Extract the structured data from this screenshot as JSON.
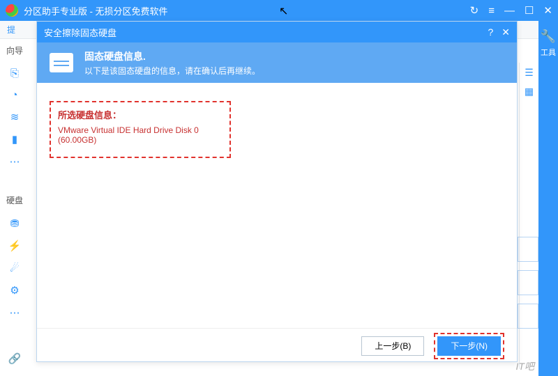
{
  "title_bar": {
    "title": "分区助手专业版 - 无损分区免费软件"
  },
  "search_strip": {
    "hint": "提"
  },
  "sidebar": {
    "section1_label": "向导",
    "section2_label": "硬盘"
  },
  "right_edge": {
    "tools_label": "工具"
  },
  "right_quick": {
    "grid_label": "☰",
    "list_label": "▦"
  },
  "dialog": {
    "title": "安全擦除固态硬盘",
    "banner": {
      "heading": "固态硬盘信息.",
      "subtitle": "以下是该固态硬盘的信息，请在确认后再继续。"
    },
    "info": {
      "header": "所选硬盘信息：",
      "line": "VMware Virtual IDE Hard Drive Disk 0 (60.00GB)"
    },
    "buttons": {
      "back": "上一步(B)",
      "next": "下一步(N)"
    }
  },
  "watermark": "IT吧"
}
